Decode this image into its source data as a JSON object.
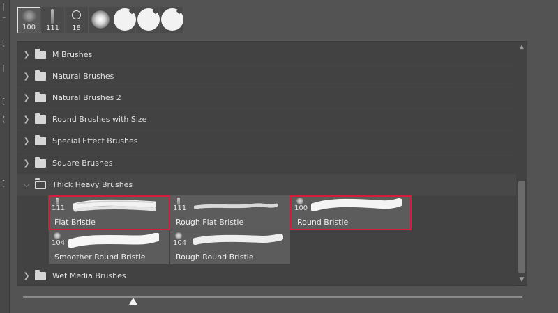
{
  "recent_brushes": [
    {
      "size": "100",
      "icon": "textured-brush-icon",
      "selected": true
    },
    {
      "size": "111",
      "icon": "bristle-brush-icon"
    },
    {
      "size": "18",
      "icon": "round-outline-brush-icon"
    },
    {
      "icon": "soft-round-brush-icon"
    },
    {
      "icon": "hard-round-pressure-brush-icon"
    },
    {
      "icon": "hard-round-pressure-brush-icon"
    },
    {
      "icon": "hard-round-pressure-brush-icon"
    }
  ],
  "folders": {
    "m_brushes": "M Brushes",
    "natural_brushes": "Natural Brushes",
    "natural_brushes_2": "Natural Brushes 2",
    "round_brushes_with_size": "Round Brushes with Size",
    "special_effect_brushes": "Special Effect Brushes",
    "square_brushes": "Square Brushes",
    "thick_heavy_brushes": "Thick Heavy Brushes",
    "wet_media_brushes": "Wet Media Brushes"
  },
  "thick_heavy_brushes": [
    {
      "size": "111",
      "name": "Flat Bristle",
      "highlighted": true
    },
    {
      "size": "111",
      "name": "Rough Flat Bristle",
      "highlighted": false
    },
    {
      "size": "100",
      "name": "Round Bristle",
      "highlighted": true
    },
    {
      "size": "104",
      "name": "Smoother Round Bristle",
      "highlighted": false
    },
    {
      "size": "104",
      "name": "Rough Round Bristle",
      "highlighted": false
    }
  ],
  "size_slider": {
    "value_fraction": 0.22
  },
  "colors": {
    "highlight": "#d41c3c",
    "panel": "#424242",
    "background": "#535353"
  }
}
